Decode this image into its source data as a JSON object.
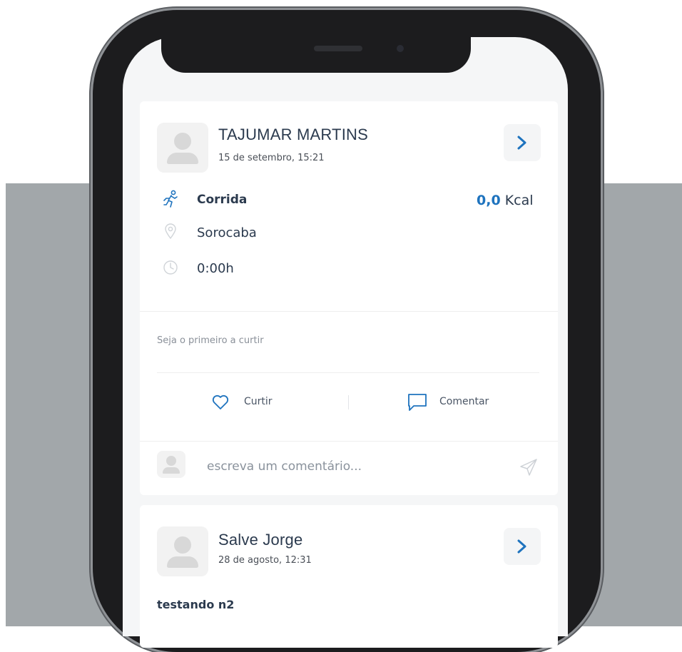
{
  "feed": {
    "post1": {
      "user_name": "TAJUMAR MARTINS",
      "date": "15 de setembro, 15:21",
      "activity": "Corrida",
      "calories_value": "0,0",
      "calories_unit": "Kcal",
      "location": "Sorocaba",
      "duration": "0:00h",
      "likes_text": "Seja o primeiro a curtir",
      "like_label": "Curtir",
      "comment_label": "Comentar",
      "comment_placeholder": "escreva um comentário..."
    },
    "post2": {
      "user_name": "Salve Jorge",
      "date": "28 de agosto, 12:31",
      "text": "testando n2"
    }
  },
  "colors": {
    "accent": "#1e73be",
    "background_band": "#a2a7aa",
    "text_primary": "#2b3a4e"
  },
  "icons": [
    "avatar-placeholder-icon",
    "chevron-right-icon",
    "running-icon",
    "location-pin-icon",
    "clock-icon",
    "heart-icon",
    "comment-icon",
    "send-icon"
  ]
}
